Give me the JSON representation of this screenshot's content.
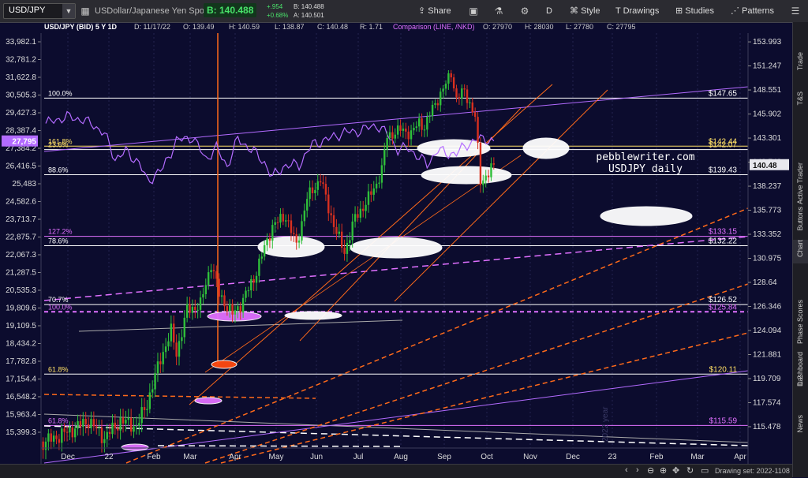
{
  "toolbar": {
    "symbol": "USD/JPY",
    "description": "USDollar/Japanese Yen Spot",
    "bid_label": "B: 140.488",
    "change_abs": "+.954",
    "change_pct": "+0.68%",
    "bid_small": "B: 140.488",
    "ask_small": "A: 140.501",
    "share": "Share",
    "period": "D",
    "style": "Style",
    "drawings": "Drawings",
    "studies": "Studies",
    "patterns": "Patterns"
  },
  "infobar": {
    "title": "USD/JPY (BID) 5 Y 1D",
    "date": "D: 11/17/22",
    "open": "O: 139.49",
    "high": "H: 140.59",
    "low": "L: 138.87",
    "close": "C: 140.48",
    "range": "R: 1.71",
    "comparison": "Comparison (LINE, /NKD)",
    "cmp_open": "O: 27970",
    "cmp_high": "H: 28030",
    "cmp_low": "L: 27780",
    "cmp_close": "C: 27795"
  },
  "axes": {
    "left": [
      "33,982.1",
      "32,781.2",
      "31,622.8",
      "30,505.3",
      "29,427.3",
      "28,387.4",
      "27,384.2",
      "26,416.5",
      "25,483",
      "24,582.6",
      "23,713.7",
      "22,875.7",
      "22,067.3",
      "21,287.5",
      "20,535.3",
      "19,809.6",
      "19,109.5",
      "18,434.2",
      "17,782.8",
      "17,154.4",
      "16,548.2",
      "15,963.4",
      "15,399.3"
    ],
    "right": [
      "153.993",
      "151.247",
      "148.551",
      "145.902",
      "143.301",
      "140.743",
      "138.237",
      "135.773",
      "133.352",
      "130.975",
      "128.64",
      "126.346",
      "124.094",
      "121.881",
      "119.709",
      "117.574",
      "115.478"
    ],
    "right_current": "140.48",
    "left_current": "27,795",
    "months": [
      "Dec",
      "22",
      "Feb",
      "Mar",
      "Apr",
      "May",
      "Jun",
      "Jul",
      "Aug",
      "Sep",
      "Oct",
      "Nov",
      "Dec",
      "23",
      "Feb",
      "Mar",
      "Apr"
    ]
  },
  "fib_levels": {
    "left": [
      "100.0%",
      "161.8%",
      "23.6%",
      "88.6%",
      "127.2%",
      "78.6%",
      "70.7%",
      "100.0%",
      "61.8%",
      "61.8%"
    ],
    "right": [
      "$147.65",
      "$142.44",
      "$142.07",
      "$139.43",
      "$133.15",
      "$132.22",
      "$126.52",
      "$125.84",
      "$120.11",
      "$115.59"
    ]
  },
  "annotation": {
    "line1": "pebblewriter.com",
    "line2": "USDJPY daily"
  },
  "watermark": "2022 year",
  "sidebar_tabs": [
    "Trade",
    "T&S",
    "Active Trader",
    "Buttons",
    "Chart",
    "Phase Scores",
    "Dashboard",
    "L 2",
    "News"
  ],
  "bottom": {
    "drawing_set": "Drawing set: 2022-1108"
  },
  "colors": {
    "background": "#0c0c2e",
    "up": "#2fbf3a",
    "down": "#d8301f",
    "comparison": "#b36bff",
    "orange": "#ff6a1a",
    "magenta": "#e070ff"
  },
  "price_data": {
    "anchors": [
      [
        -2,
        114.0
      ],
      [
        8,
        115.0
      ],
      [
        16,
        116.0
      ],
      [
        22,
        114.5
      ],
      [
        28,
        116.0
      ],
      [
        34,
        115.5
      ],
      [
        38,
        117.5
      ],
      [
        43,
        121.5
      ],
      [
        47,
        124.0
      ],
      [
        49,
        122.0
      ],
      [
        53,
        126.0
      ],
      [
        58,
        126.5
      ],
      [
        62,
        130.5
      ],
      [
        65,
        127.5
      ],
      [
        70,
        125.6
      ],
      [
        73,
        126.5
      ],
      [
        78,
        129.0
      ],
      [
        80,
        130.5
      ],
      [
        85,
        134.2
      ],
      [
        90,
        135.2
      ],
      [
        94,
        132.2
      ],
      [
        98,
        137.0
      ],
      [
        103,
        139.0
      ],
      [
        106,
        136.0
      ],
      [
        109,
        133.5
      ],
      [
        112,
        131.6
      ],
      [
        116,
        135.0
      ],
      [
        120,
        136.5
      ],
      [
        124,
        138.5
      ],
      [
        126,
        140.0
      ],
      [
        128,
        143.5
      ],
      [
        133,
        144.2
      ],
      [
        137,
        143.8
      ],
      [
        140,
        145.0
      ],
      [
        142,
        144.5
      ],
      [
        145,
        146.5
      ],
      [
        150,
        149.2
      ],
      [
        152,
        150.5
      ],
      [
        154,
        147.5
      ],
      [
        157,
        148.5
      ],
      [
        159,
        147.0
      ],
      [
        161,
        145.5
      ],
      [
        163,
        138.8
      ],
      [
        166,
        139.5
      ],
      [
        168,
        140.48
      ]
    ],
    "comparison": [
      [
        0,
        28800
      ],
      [
        8,
        29200
      ],
      [
        14,
        29000
      ],
      [
        18,
        28700
      ],
      [
        22,
        28200
      ],
      [
        26,
        26800
      ],
      [
        30,
        27200
      ],
      [
        35,
        26600
      ],
      [
        38,
        25600
      ],
      [
        44,
        26300
      ],
      [
        49,
        27800
      ],
      [
        55,
        28000
      ],
      [
        60,
        26800
      ],
      [
        64,
        27400
      ],
      [
        68,
        26400
      ],
      [
        72,
        27900
      ],
      [
        78,
        27200
      ],
      [
        82,
        26600
      ],
      [
        85,
        25800
      ],
      [
        89,
        26400
      ],
      [
        95,
        26500
      ],
      [
        100,
        27600
      ],
      [
        106,
        27900
      ],
      [
        112,
        28300
      ],
      [
        116,
        28300
      ],
      [
        120,
        28500
      ],
      [
        124,
        28700
      ],
      [
        128,
        28200
      ],
      [
        132,
        27300
      ],
      [
        136,
        27400
      ],
      [
        139,
        27000
      ],
      [
        143,
        26500
      ],
      [
        147,
        27300
      ],
      [
        150,
        27100
      ],
      [
        154,
        27100
      ],
      [
        158,
        27600
      ],
      [
        162,
        27900
      ],
      [
        166,
        27900
      ],
      [
        168,
        27795
      ]
    ]
  }
}
